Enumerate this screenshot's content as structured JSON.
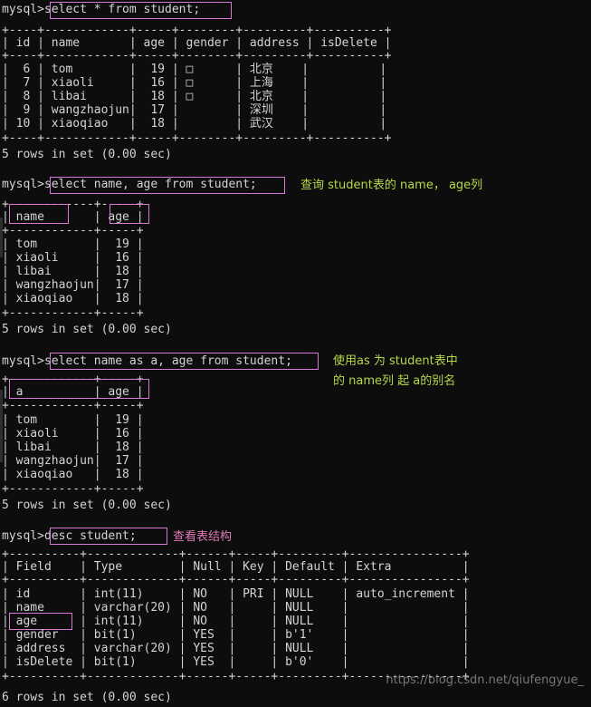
{
  "terminal": {
    "prompt": "mysql>",
    "colors": {
      "background": "#0d0d0d",
      "text": "#d4d4d4",
      "highlight_box": "#d678d6",
      "note_green": "#b5d94a",
      "note_pink": "#e07ab8",
      "watermark": "#8a8a8a"
    }
  },
  "watermark": {
    "text": "https://blog.csdn.net/qiufengyue_"
  },
  "blocks": [
    {
      "id": "select-star",
      "command": "select * from student;",
      "prompt_line": "mysql>select * from student;",
      "note": "",
      "table": {
        "sep": "+----+------------+-----+--------+---------+----------+",
        "header": "| id | name       | age | gender | address | isDelete |",
        "rows": [
          "|  6 | tom        |  19 | □      | 北京    |          |",
          "|  7 | xiaoli     |  16 | □      | 上海    |          |",
          "|  8 | libai      |  18 | □      | 北京    |          |",
          "|  9 | wangzhaojun|  17 |        | 深圳    |          |",
          "| 10 | xiaoqiao   |  18 |        | 武汉    |          |"
        ],
        "columns": [
          "id",
          "name",
          "age",
          "gender",
          "address",
          "isDelete"
        ],
        "data": [
          {
            "id": "6",
            "name": "tom",
            "age": "19",
            "gender": "□",
            "address": "北京",
            "isDelete": ""
          },
          {
            "id": "7",
            "name": "xiaoli",
            "age": "16",
            "gender": "□",
            "address": "上海",
            "isDelete": ""
          },
          {
            "id": "8",
            "name": "libai",
            "age": "18",
            "gender": "□",
            "address": "北京",
            "isDelete": ""
          },
          {
            "id": "9",
            "name": "wangzhaojun",
            "age": "17",
            "gender": "",
            "address": "深圳",
            "isDelete": ""
          },
          {
            "id": "10",
            "name": "xiaoqiao",
            "age": "18",
            "gender": "",
            "address": "武汉",
            "isDelete": ""
          }
        ]
      },
      "result": "5 rows in set (0.00 sec)"
    },
    {
      "id": "select-name-age",
      "command": "select name, age from student;",
      "prompt_line": "mysql>select name, age from student;",
      "note": "查询 student表的 name， age列",
      "table": {
        "sep": "+------------+-----+",
        "header": "| name       | age |",
        "rows": [
          "| tom        |  19 |",
          "| xiaoli     |  16 |",
          "| libai      |  18 |",
          "| wangzhaojun|  17 |",
          "| xiaoqiao   |  18 |"
        ],
        "columns": [
          "name",
          "age"
        ],
        "data": [
          {
            "name": "tom",
            "age": "19"
          },
          {
            "name": "xiaoli",
            "age": "16"
          },
          {
            "name": "libai",
            "age": "18"
          },
          {
            "name": "wangzhaojun",
            "age": "17"
          },
          {
            "name": "xiaoqiao",
            "age": "18"
          }
        ]
      },
      "result": "5 rows in set (0.00 sec)"
    },
    {
      "id": "select-name-as-a",
      "command": "select name as a, age from student;",
      "prompt_line": "mysql>select name as a, age from student;",
      "note_line1": "使用as 为 student表中",
      "note_line2": "的 name列 起 a的别名",
      "table": {
        "sep": "+------------+-----+",
        "header": "| a          | age |",
        "rows": [
          "| tom        |  19 |",
          "| xiaoli     |  16 |",
          "| libai      |  18 |",
          "| wangzhaojun|  17 |",
          "| xiaoqiao   |  18 |"
        ],
        "columns": [
          "a",
          "age"
        ],
        "data": [
          {
            "a": "tom",
            "age": "19"
          },
          {
            "a": "xiaoli",
            "age": "16"
          },
          {
            "a": "libai",
            "age": "18"
          },
          {
            "a": "wangzhaojun",
            "age": "17"
          },
          {
            "a": "xiaoqiao",
            "age": "18"
          }
        ]
      },
      "result": "5 rows in set (0.00 sec)"
    },
    {
      "id": "desc-student",
      "command": "desc student;",
      "prompt_line": "mysql>desc student;",
      "note": "查看表结构",
      "table": {
        "sep": "+----------+-------------+------+-----+---------+----------------+",
        "header": "| Field    | Type        | Null | Key | Default | Extra          |",
        "rows": [
          "| id       | int(11)     | NO   | PRI | NULL    | auto_increment |",
          "| name     | varchar(20) | NO   |     | NULL    |                |",
          "| age      | int(11)     | NO   |     | NULL    |                |",
          "| gender   | bit(1)      | YES  |     | b'1'    |                |",
          "| address  | varchar(20) | YES  |     | NULL    |                |",
          "| isDelete | bit(1)      | YES  |     | b'0'    |                |"
        ],
        "columns": [
          "Field",
          "Type",
          "Null",
          "Key",
          "Default",
          "Extra"
        ],
        "data": [
          {
            "Field": "id",
            "Type": "int(11)",
            "Null": "NO",
            "Key": "PRI",
            "Default": "NULL",
            "Extra": "auto_increment"
          },
          {
            "Field": "name",
            "Type": "varchar(20)",
            "Null": "NO",
            "Key": "",
            "Default": "NULL",
            "Extra": ""
          },
          {
            "Field": "age",
            "Type": "int(11)",
            "Null": "NO",
            "Key": "",
            "Default": "NULL",
            "Extra": ""
          },
          {
            "Field": "gender",
            "Type": "bit(1)",
            "Null": "YES",
            "Key": "",
            "Default": "b'1'",
            "Extra": ""
          },
          {
            "Field": "address",
            "Type": "varchar(20)",
            "Null": "YES",
            "Key": "",
            "Default": "NULL",
            "Extra": ""
          },
          {
            "Field": "isDelete",
            "Type": "bit(1)",
            "Null": "YES",
            "Key": "",
            "Default": "b'0'",
            "Extra": ""
          }
        ]
      },
      "result": "6 rows in set (0.00 sec)"
    }
  ]
}
